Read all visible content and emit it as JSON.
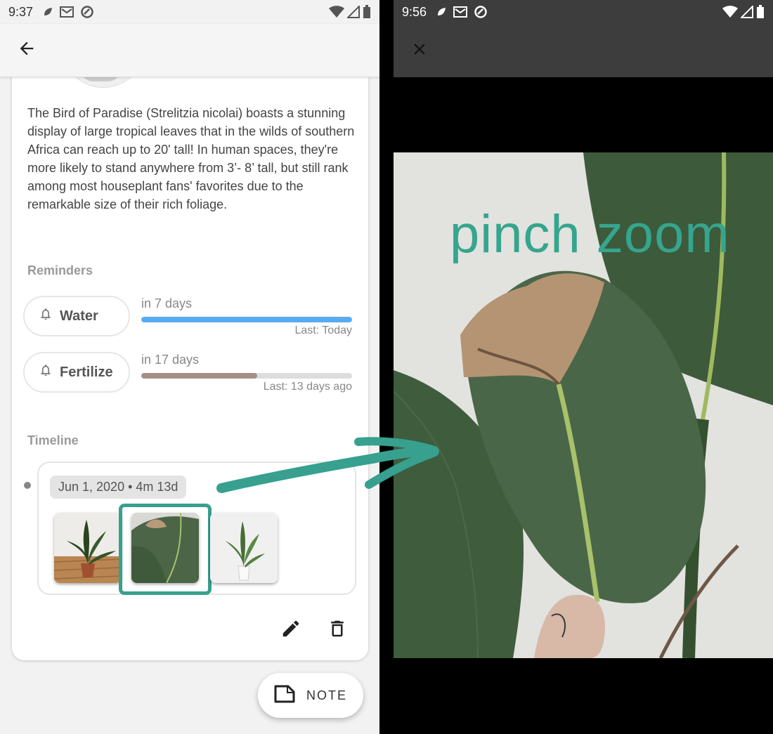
{
  "left_screen": {
    "status_time": "9:37",
    "description": "The Bird of Paradise (Strelitzia nicolai) boasts a stunning display of large tropical leaves that in the wilds of southern Africa can reach up to 20' tall! In human spaces, they're more likely to stand anywhere from 3’- 8’ tall, but still rank among most houseplant fans' favorites due to the remarkable size of their rich foliage.",
    "reminders_title": "Reminders",
    "reminders": [
      {
        "label": "Water",
        "when": "in 7 days",
        "last": "Last: Today",
        "progress": 1.0,
        "color": "#5aaaf0"
      },
      {
        "label": "Fertilize",
        "when": "in 17 days",
        "last": "Last: 13 days ago",
        "progress": 0.55,
        "color": "#a58f85"
      }
    ],
    "timeline_title": "Timeline",
    "timeline_entry": {
      "date": "Jun 1, 2020 • 4m 13d",
      "thumbnails": [
        "potted-plant-on-table",
        "leaf-closeup-selected",
        "potted-plant-white-pot"
      ]
    },
    "fab_label": "NOTE"
  },
  "right_screen": {
    "status_time": "9:56",
    "caption": "pinch zoom"
  },
  "colors": {
    "accent": "#37a08e",
    "water_bar": "#5aaaf0",
    "fertilize_bar": "#a58f85"
  }
}
